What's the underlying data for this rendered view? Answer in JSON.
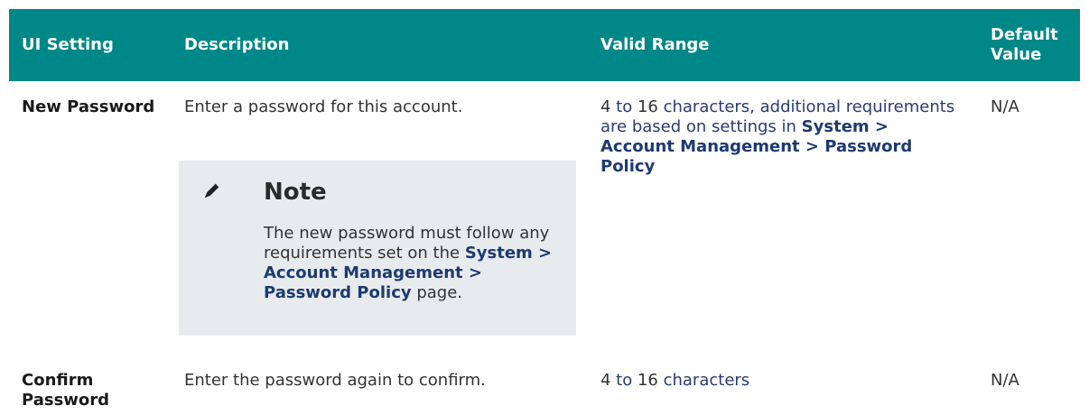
{
  "header": {
    "col1": "UI Setting",
    "col2": "Description",
    "col3": "Valid Range",
    "col4": "Default Value"
  },
  "rows": [
    {
      "setting": "New Password",
      "description": "Enter a password for this account.",
      "range": {
        "min": "4",
        "to": " to ",
        "max": "16",
        "text": " characters, additional requirements are based on settings in ",
        "link": "System > Account Management > Password Policy"
      },
      "default": "N/A",
      "note": {
        "icon": "pencil-icon",
        "title": "Note",
        "body_text": "The new password must follow any requirements set on the ",
        "body_link": "System > Account Management > Password Policy",
        "body_suffix": " page."
      }
    },
    {
      "setting": "Confirm Password",
      "description": "Enter the password again to confirm.",
      "range": {
        "min": "4",
        "to": " to ",
        "max": "16",
        "text": " characters"
      },
      "default": "N/A"
    }
  ],
  "colors": {
    "header_bg": "#008787",
    "header_text": "#ffffff",
    "note_bg": "#e8ebed",
    "link": "#1d3a70"
  }
}
